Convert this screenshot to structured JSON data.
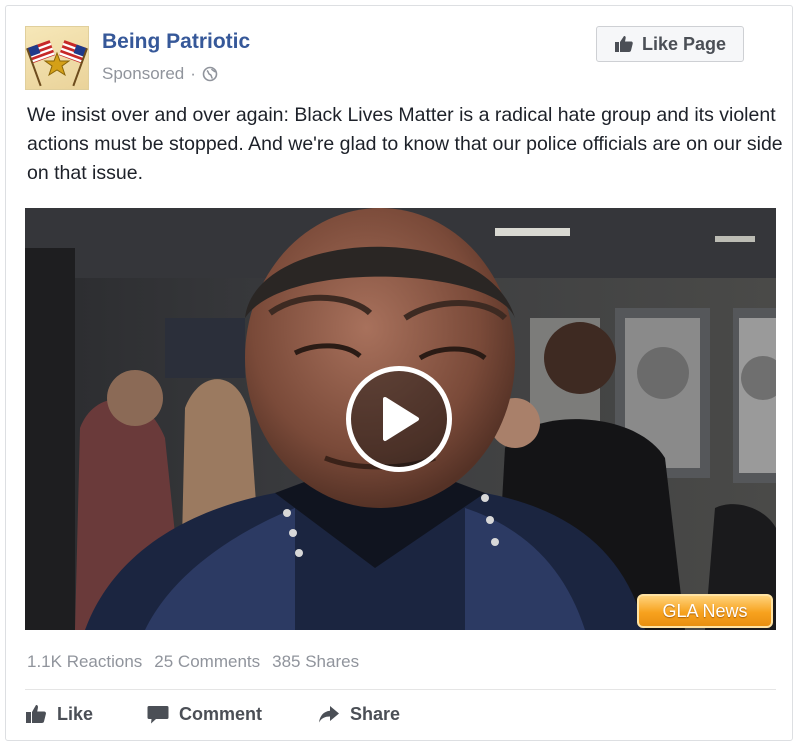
{
  "post": {
    "page_name": "Being Patriotic",
    "sponsored_label": "Sponsored",
    "meta_separator": "·",
    "like_page_label": "Like Page",
    "text": "We insist over and over again: Black Lives Matter is a radical hate group and its violent actions must be stopped. And we're glad to know that our police officials are on our side on that issue."
  },
  "video": {
    "badge": "GLA News"
  },
  "stats": {
    "reactions": "1.1K Reactions",
    "comments": "25 Comments",
    "shares": "385 Shares"
  },
  "actions": {
    "like": "Like",
    "comment": "Comment",
    "share": "Share"
  },
  "icons": {
    "avatar": "flags-eagle-logo",
    "privacy": "globe-icon",
    "like_page": "thumbs-up-icon",
    "play": "play-icon",
    "like": "thumbs-up-icon",
    "comment": "speech-bubble-icon",
    "share": "share-arrow-icon"
  },
  "colors": {
    "page_name": "#365899",
    "text": "#1d2129",
    "meta": "#90949c",
    "action": "#4b4f56",
    "badge": "#f7a21e"
  }
}
